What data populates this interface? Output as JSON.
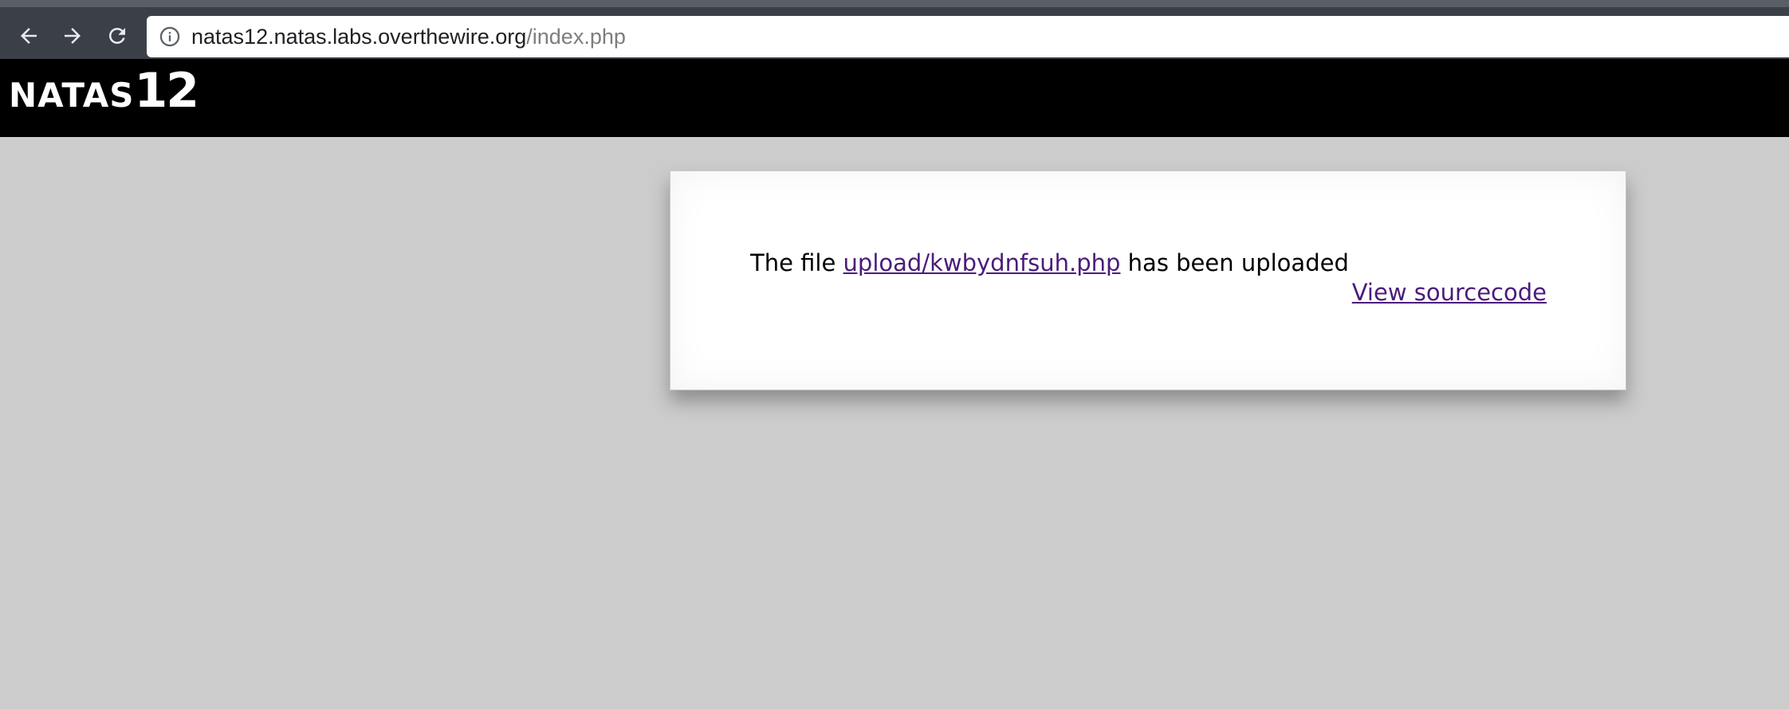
{
  "browser": {
    "nav": {
      "back_icon": "arrow-left-icon",
      "forward_icon": "arrow-right-icon",
      "reload_icon": "reload-icon"
    },
    "address": {
      "info_icon": "info-icon",
      "host": "natas12.natas.labs.overthewire.org",
      "path": "/index.php"
    }
  },
  "header": {
    "title_text": "NATAS",
    "title_number": "12"
  },
  "content": {
    "message_prefix": "The file ",
    "uploaded_file_link": "upload/kwbydnfsuh.php",
    "message_suffix": " has been uploaded",
    "view_source_link": "View sourcecode"
  },
  "colors": {
    "page_background": "#cccccc",
    "header_background": "#000000",
    "link": "#4b1c7b",
    "browser_chrome": "#3b4048"
  }
}
